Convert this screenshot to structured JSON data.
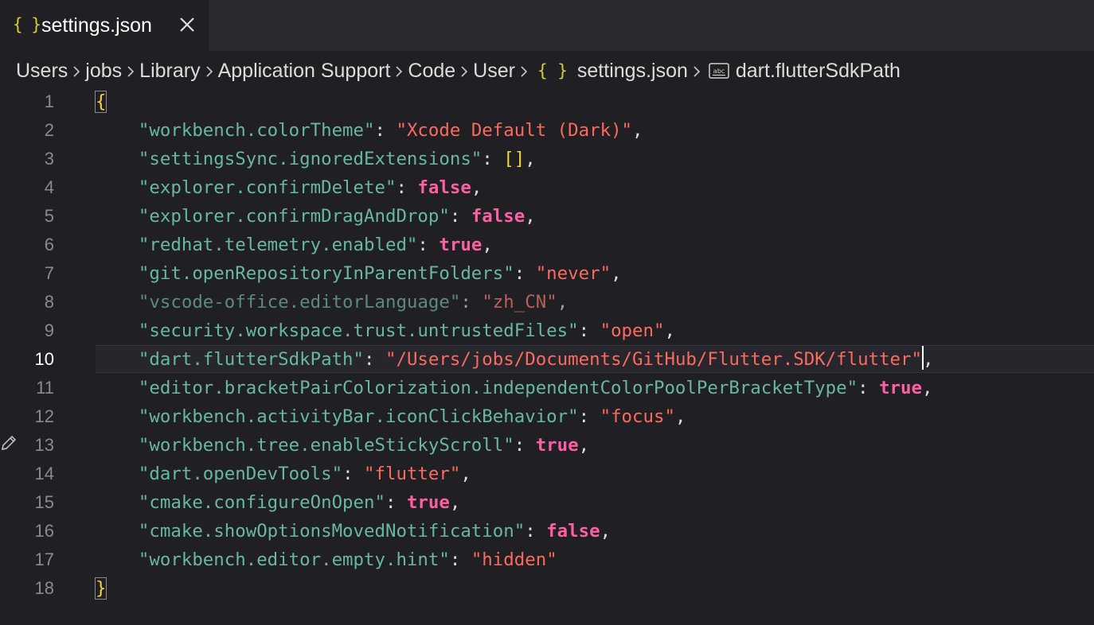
{
  "tab": {
    "icon_text": "{ }",
    "label": "settings.json"
  },
  "breadcrumb": [
    {
      "label": "Users"
    },
    {
      "label": "jobs"
    },
    {
      "label": "Library"
    },
    {
      "label": "Application Support"
    },
    {
      "label": "Code"
    },
    {
      "label": "User"
    },
    {
      "label": "settings.json",
      "icon_text": "{ }"
    },
    {
      "label": "dart.flutterSdkPath",
      "icon": "string-symbol-icon"
    }
  ],
  "editor": {
    "current_line": 10,
    "lines": [
      {
        "n": "1",
        "open": "{"
      },
      {
        "n": "2",
        "key": "\"workbench.colorTheme\"",
        "value": "\"Xcode Default (Dark)\"",
        "vtype": "s",
        "comma": ","
      },
      {
        "n": "3",
        "key": "\"settingsSync.ignoredExtensions\"",
        "value": "[]",
        "vtype": "br",
        "comma": ","
      },
      {
        "n": "4",
        "key": "\"explorer.confirmDelete\"",
        "value": "false",
        "vtype": "b",
        "comma": ","
      },
      {
        "n": "5",
        "key": "\"explorer.confirmDragAndDrop\"",
        "value": "false",
        "vtype": "b",
        "comma": ","
      },
      {
        "n": "6",
        "key": "\"redhat.telemetry.enabled\"",
        "value": "true",
        "vtype": "b",
        "comma": ","
      },
      {
        "n": "7",
        "key": "\"git.openRepositoryInParentFolders\"",
        "value": "\"never\"",
        "vtype": "s",
        "comma": ","
      },
      {
        "n": "8",
        "key": "\"vscode-office.editorLanguage\"",
        "value": "\"zh_CN\"",
        "vtype": "s",
        "comma": ",",
        "dim": true
      },
      {
        "n": "9",
        "key": "\"security.workspace.trust.untrustedFiles\"",
        "value": "\"open\"",
        "vtype": "s",
        "comma": ","
      },
      {
        "n": "10",
        "key": "\"dart.flutterSdkPath\"",
        "value": "\"/Users/jobs/Documents/GitHub/Flutter.SDK/flutter\"",
        "vtype": "s",
        "comma": ",",
        "cursor": true
      },
      {
        "n": "11",
        "key": "\"editor.bracketPairColorization.independentColorPoolPerBracketType\"",
        "value": "true",
        "vtype": "b",
        "comma": ","
      },
      {
        "n": "12",
        "key": "\"workbench.activityBar.iconClickBehavior\"",
        "value": "\"focus\"",
        "vtype": "s",
        "comma": ","
      },
      {
        "n": "13",
        "key": "\"workbench.tree.enableStickyScroll\"",
        "value": "true",
        "vtype": "b",
        "comma": ","
      },
      {
        "n": "14",
        "key": "\"dart.openDevTools\"",
        "value": "\"flutter\"",
        "vtype": "s",
        "comma": ","
      },
      {
        "n": "15",
        "key": "\"cmake.configureOnOpen\"",
        "value": "true",
        "vtype": "b",
        "comma": ","
      },
      {
        "n": "16",
        "key": "\"cmake.showOptionsMovedNotification\"",
        "value": "false",
        "vtype": "b",
        "comma": ","
      },
      {
        "n": "17",
        "key": "\"workbench.editor.empty.hint\"",
        "value": "\"hidden\"",
        "vtype": "s",
        "comma": ""
      },
      {
        "n": "18",
        "close": "}"
      }
    ]
  },
  "colors": {
    "key": "#67b7a4",
    "string": "#fc6a5d",
    "boolean": "#fc5fa3",
    "bracket": "#f3d54a",
    "background": "#1f1f24"
  }
}
